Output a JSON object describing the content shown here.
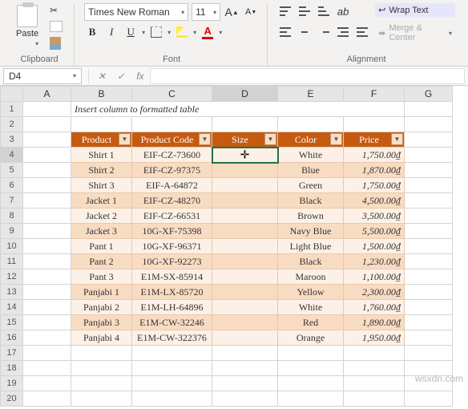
{
  "ribbon": {
    "clipboard": {
      "label": "Clipboard",
      "paste": "Paste"
    },
    "font": {
      "label": "Font",
      "name": "Times New Roman",
      "size": "11",
      "increase": "A^",
      "decrease": "A˅",
      "bold": "B",
      "italic": "I",
      "underline": "U",
      "fontcolor": "A"
    },
    "alignment": {
      "label": "Alignment",
      "wrap": "Wrap Text",
      "merge": "Merge & Center"
    }
  },
  "namebox": "D4",
  "fx_cancel": "✕",
  "fx_enter": "✓",
  "fx_label": "fx",
  "columns": [
    "A",
    "B",
    "C",
    "D",
    "E",
    "F",
    "G"
  ],
  "row_numbers": [
    1,
    2,
    3,
    4,
    5,
    6,
    7,
    8,
    9,
    10,
    11,
    12,
    13,
    14,
    15,
    16,
    17,
    18,
    19,
    20
  ],
  "subtitle": "Insert column to formatted table",
  "table": {
    "headers": [
      "Product",
      "Product Code",
      "Size",
      "Color",
      "Price"
    ],
    "rows": [
      {
        "p": "Shirt 1",
        "c": "EIF-CZ-73600",
        "s": "",
        "col": "White",
        "pr": "1,750.00₫"
      },
      {
        "p": "Shirt 2",
        "c": "EIF-CZ-97375",
        "s": "",
        "col": "Blue",
        "pr": "1,870.00₫"
      },
      {
        "p": "Shirt 3",
        "c": "EIF-A-64872",
        "s": "",
        "col": "Green",
        "pr": "1,750.00₫"
      },
      {
        "p": "Jacket 1",
        "c": "EIF-CZ-48270",
        "s": "",
        "col": "Black",
        "pr": "4,500.00₫"
      },
      {
        "p": "Jacket 2",
        "c": "EIF-CZ-66531",
        "s": "",
        "col": "Brown",
        "pr": "3,500.00₫"
      },
      {
        "p": "Jacket 3",
        "c": "10G-XF-75398",
        "s": "",
        "col": "Navy Blue",
        "pr": "5,500.00₫"
      },
      {
        "p": "Pant 1",
        "c": "10G-XF-96371",
        "s": "",
        "col": "Light Blue",
        "pr": "1,500.00₫"
      },
      {
        "p": "Pant 2",
        "c": "10G-XF-92273",
        "s": "",
        "col": "Black",
        "pr": "1,230.00₫"
      },
      {
        "p": "Pant 3",
        "c": "E1M-SX-85914",
        "s": "",
        "col": "Maroon",
        "pr": "1,100.00₫"
      },
      {
        "p": "Panjabi 1",
        "c": "E1M-LX-85720",
        "s": "",
        "col": "Yellow",
        "pr": "2,300.00₫"
      },
      {
        "p": "Panjabi 2",
        "c": "E1M-LH-64896",
        "s": "",
        "col": "White",
        "pr": "1,760.00₫"
      },
      {
        "p": "Panjabi 3",
        "c": "E1M-CW-32246",
        "s": "",
        "col": "Red",
        "pr": "1,890.00₫"
      },
      {
        "p": "Panjabi 4",
        "c": "E1M-CW-322376",
        "s": "",
        "col": "Orange",
        "pr": "1,950.00₫"
      }
    ]
  },
  "watermark": "wsxdn.com"
}
